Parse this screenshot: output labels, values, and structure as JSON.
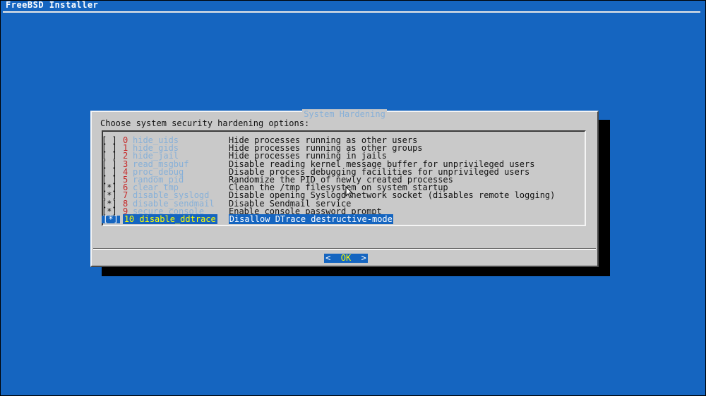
{
  "window": {
    "title": "FreeBSD Installer"
  },
  "dialog": {
    "title": "System Hardening",
    "prompt": "Choose system security hardening options:",
    "options": [
      {
        "check": "[ ]",
        "num": "0",
        "name": "hide_uids",
        "desc": "Hide processes running as other users"
      },
      {
        "check": "[ ]",
        "num": "1",
        "name": "hide_gids",
        "desc": "Hide processes running as other groups"
      },
      {
        "check": "[ ]",
        "num": "2",
        "name": "hide_jail",
        "desc": "Hide processes running in jails"
      },
      {
        "check": "[ ]",
        "num": "3",
        "name": "read_msgbuf",
        "desc": "Disable reading kernel message buffer for unprivileged users"
      },
      {
        "check": "[ ]",
        "num": "4",
        "name": "proc_debug",
        "desc": "Disable process debugging facilities for unprivileged users"
      },
      {
        "check": "[ ]",
        "num": "5",
        "name": "random_pid",
        "desc": "Randomize the PID of newly created processes"
      },
      {
        "check": "[*]",
        "num": "6",
        "name": "clear_tmp",
        "desc": "Clean the /tmp filesystem on system startup"
      },
      {
        "check": "[*]",
        "num": "7",
        "name": "disable_syslogd",
        "desc": "Disable opening Syslogd network socket (disables remote logging)"
      },
      {
        "check": "[*]",
        "num": "8",
        "name": "disable_sendmail",
        "desc": "Disable Sendmail service"
      },
      {
        "check": "[*]",
        "num": "9",
        "name": "secure_console",
        "desc": "Enable console password prompt"
      },
      {
        "check": "[*]",
        "num": "10",
        "name": "disable_ddtrace",
        "desc": "Disallow DTrace destructive-mode"
      }
    ],
    "selected_index": 10,
    "ok_button": {
      "left": "<",
      "hot": "OK",
      "right": ">"
    }
  },
  "colors": {
    "background": "#1565c0",
    "dialog_bg": "#c9c9c9",
    "option_number": "#c62828",
    "option_name": "#87b0d8",
    "hotkey": "#ffff00"
  },
  "icons": {
    "cursor": "mouse-pointer-icon"
  }
}
